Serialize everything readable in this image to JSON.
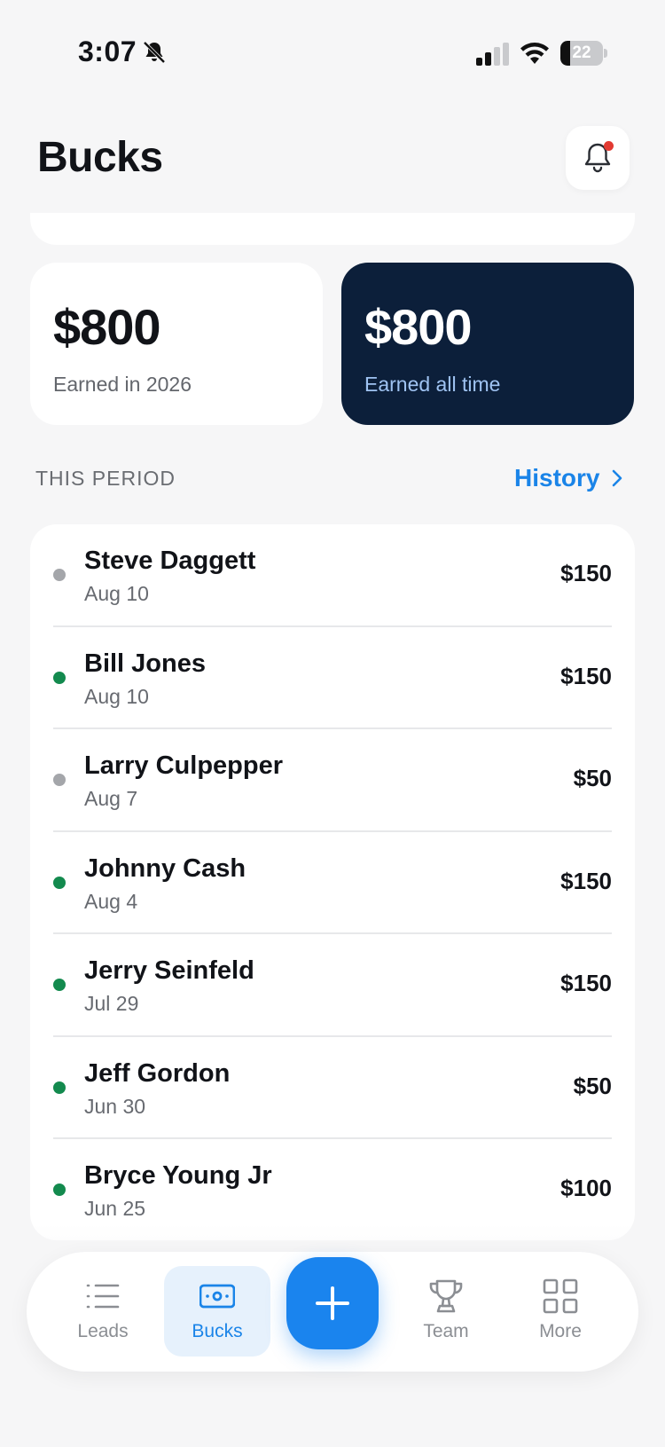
{
  "status_bar": {
    "time": "3:07",
    "battery_level": "22",
    "battery_fraction": 0.22
  },
  "header": {
    "title": "Bucks",
    "notification_dot_color": "#e23a32"
  },
  "stats": [
    {
      "value": "$800",
      "label": "Earned in 2026",
      "style": "light"
    },
    {
      "value": "$800",
      "label": "Earned all time",
      "style": "dark"
    }
  ],
  "section": {
    "title": "THIS PERIOD",
    "history_label": "History"
  },
  "colors": {
    "accent": "#1a84e8",
    "dark_card": "#0c1f3a",
    "status_paid": "#138a4e",
    "status_pending": "#a4a6aa"
  },
  "entries": [
    {
      "name": "Steve Daggett",
      "date": "Aug 10",
      "amount": "$150",
      "status": "pending"
    },
    {
      "name": "Bill Jones",
      "date": "Aug 10",
      "amount": "$150",
      "status": "paid"
    },
    {
      "name": "Larry Culpepper",
      "date": "Aug 7",
      "amount": "$50",
      "status": "pending"
    },
    {
      "name": "Johnny Cash",
      "date": "Aug 4",
      "amount": "$150",
      "status": "paid"
    },
    {
      "name": "Jerry Seinfeld",
      "date": "Jul 29",
      "amount": "$150",
      "status": "paid"
    },
    {
      "name": "Jeff Gordon",
      "date": "Jun 30",
      "amount": "$50",
      "status": "paid"
    },
    {
      "name": "Bryce Young Jr",
      "date": "Jun 25",
      "amount": "$100",
      "status": "paid"
    }
  ],
  "nav": {
    "items": [
      {
        "label": "Leads",
        "icon": "list-icon",
        "active": false
      },
      {
        "label": "Bucks",
        "icon": "cash-icon",
        "active": true
      },
      {
        "label": "Team",
        "icon": "trophy-icon",
        "active": false
      },
      {
        "label": "More",
        "icon": "grid-icon",
        "active": false
      }
    ],
    "fab_icon": "plus-icon"
  }
}
